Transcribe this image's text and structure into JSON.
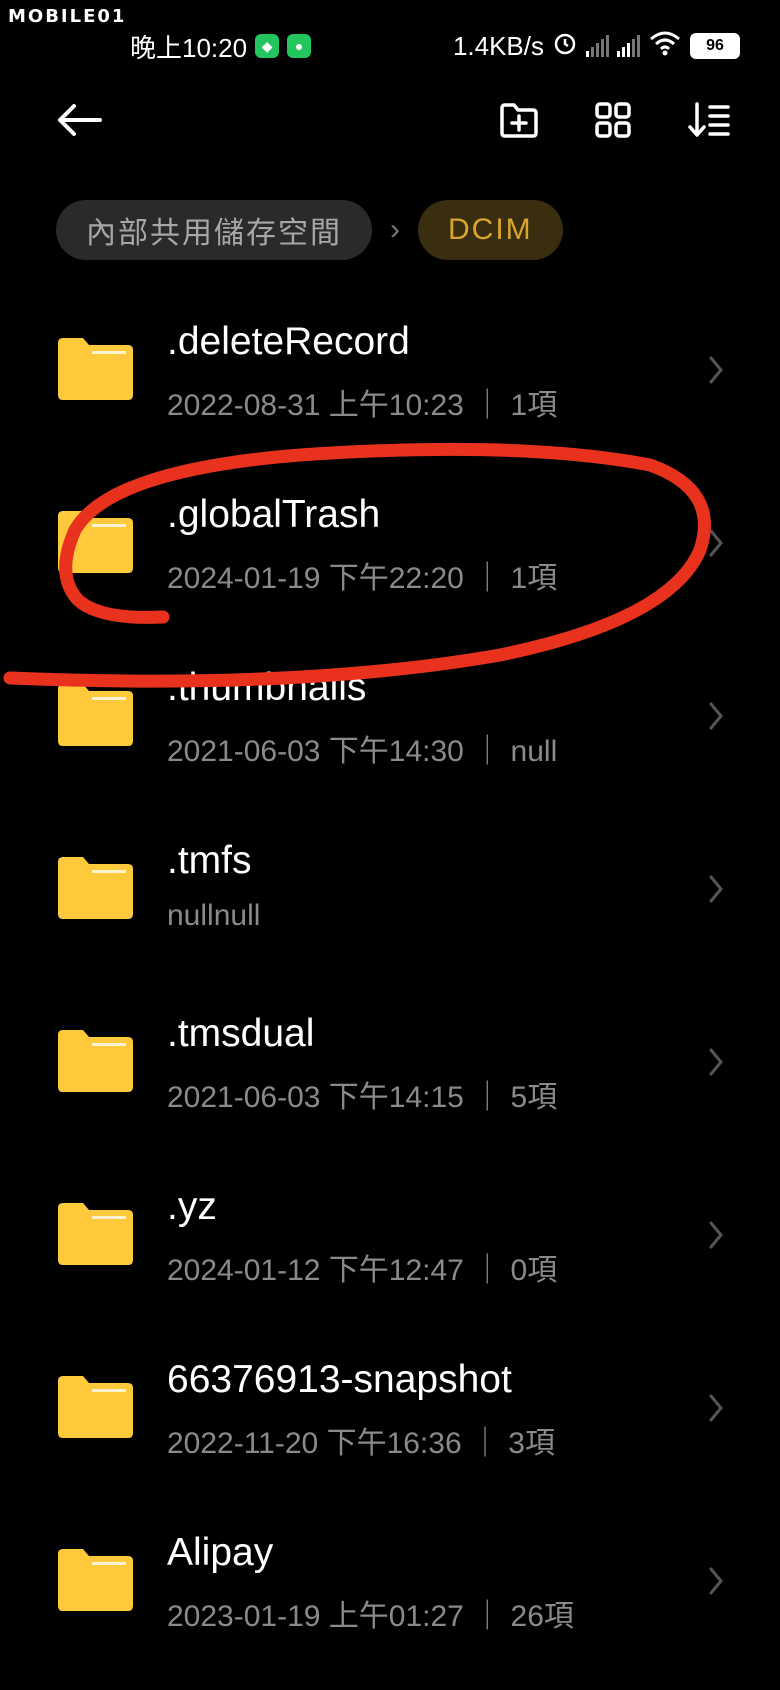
{
  "watermark": "MOBILE01",
  "status_bar": {
    "time": "晚上10:20",
    "network_speed": "1.4KB/s",
    "battery_level": "96",
    "icons": [
      "shield-app-icon",
      "wechat-icon",
      "alarm-icon",
      "hd-signal-icon",
      "signal-icon",
      "wifi-icon",
      "battery-icon"
    ]
  },
  "toolbar": {
    "back_icon": "back-arrow-icon",
    "new_folder_icon": "new-folder-icon",
    "grid_view_icon": "grid-view-icon",
    "sort_icon": "sort-icon"
  },
  "breadcrumb": {
    "root": "內部共用儲存空間",
    "separator": "›",
    "current": "DCIM"
  },
  "folders": [
    {
      "name": ".deleteRecord",
      "meta": "2022-08-31 上午10:23 ｜ 1項"
    },
    {
      "name": ".globalTrash",
      "meta": "2024-01-19 下午22:20 ｜ 1項"
    },
    {
      "name": ".thumbnails",
      "meta": "2021-06-03 下午14:30 ｜ null"
    },
    {
      "name": ".tmfs",
      "meta": "nullnull"
    },
    {
      "name": ".tmsdual",
      "meta": "2021-06-03 下午14:15 ｜ 5項"
    },
    {
      "name": ".yz",
      "meta": "2024-01-12 下午12:47 ｜ 0項"
    },
    {
      "name": "66376913-snapshot",
      "meta": "2022-11-20 下午16:36 ｜ 3項"
    },
    {
      "name": "Alipay",
      "meta": "2023-01-19 上午01:27 ｜ 26項"
    }
  ],
  "colors": {
    "background": "#000000",
    "folder": "#ffc93c",
    "accent": "#d9a52e",
    "annotation": "#e8321e"
  }
}
